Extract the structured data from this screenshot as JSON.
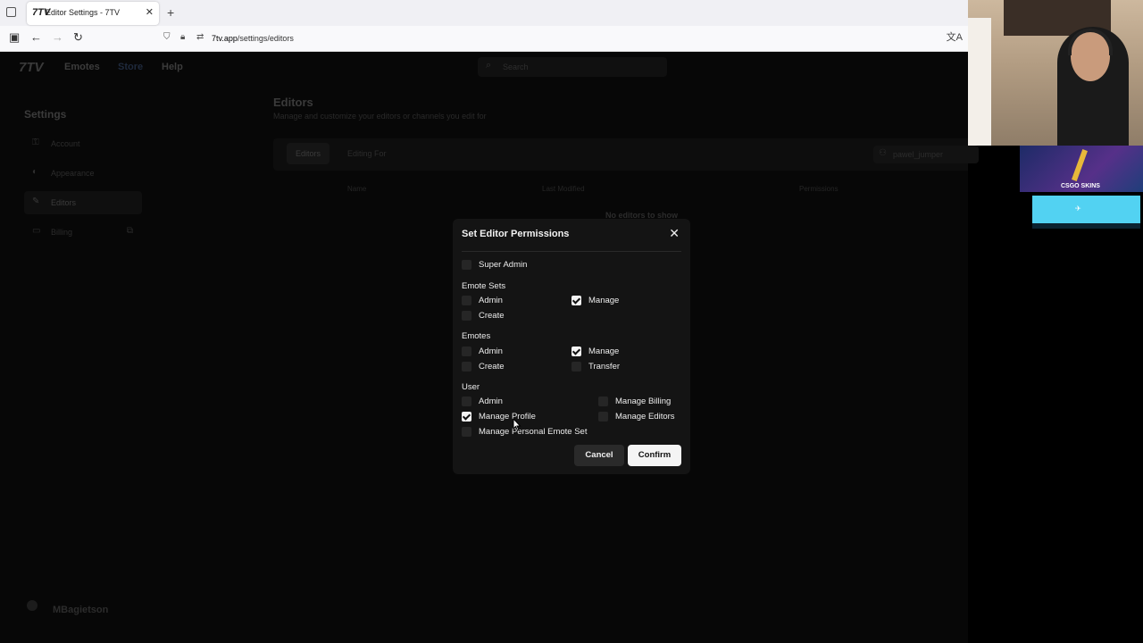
{
  "browser": {
    "tab_title": "Editor Settings - 7TV",
    "tab_favicon": "7TV",
    "url_host": "7tv.app",
    "url_path": "/settings/editors"
  },
  "app": {
    "logo": "7TV",
    "nav": [
      "Emotes",
      "Store",
      "Help"
    ],
    "search_placeholder": "Search",
    "settings_title": "Settings",
    "sidebar": [
      {
        "label": "Account",
        "icon": "key-icon"
      },
      {
        "label": "Appearance",
        "icon": "palette-icon"
      },
      {
        "label": "Editors",
        "icon": "pencil-icon"
      },
      {
        "label": "Billing",
        "icon": "card-icon"
      }
    ],
    "page_title": "Editors",
    "page_subtitle": "Manage and customize your editors or channels you edit for",
    "tabs": [
      "Editors",
      "Editing For"
    ],
    "editor_user": "pawel_jumper",
    "table_headers": [
      "Name",
      "Last Modified",
      "Permissions"
    ],
    "empty_text": "No editors to show",
    "current_user": "MBagietson"
  },
  "modal": {
    "title": "Set Editor Permissions",
    "super_admin": {
      "label": "Super Admin",
      "checked": false
    },
    "groups": {
      "emote_sets": {
        "title": "Emote Sets",
        "admin": {
          "label": "Admin",
          "checked": false
        },
        "create": {
          "label": "Create",
          "checked": false
        },
        "manage": {
          "label": "Manage",
          "checked": true
        }
      },
      "emotes": {
        "title": "Emotes",
        "admin": {
          "label": "Admin",
          "checked": false
        },
        "create": {
          "label": "Create",
          "checked": false
        },
        "manage": {
          "label": "Manage",
          "checked": true
        },
        "transfer": {
          "label": "Transfer",
          "checked": false
        }
      },
      "user": {
        "title": "User",
        "admin": {
          "label": "Admin",
          "checked": false
        },
        "manage_profile": {
          "label": "Manage Profile",
          "checked": true
        },
        "manage_personal_emote_set": {
          "label": "Manage Personal Emote Set",
          "checked": false
        },
        "manage_billing": {
          "label": "Manage Billing",
          "checked": false
        },
        "manage_editors": {
          "label": "Manage Editors",
          "checked": false
        }
      }
    },
    "cancel_label": "Cancel",
    "confirm_label": "Confirm"
  },
  "overlay": {
    "skins_text": "CSGO SKINS"
  }
}
